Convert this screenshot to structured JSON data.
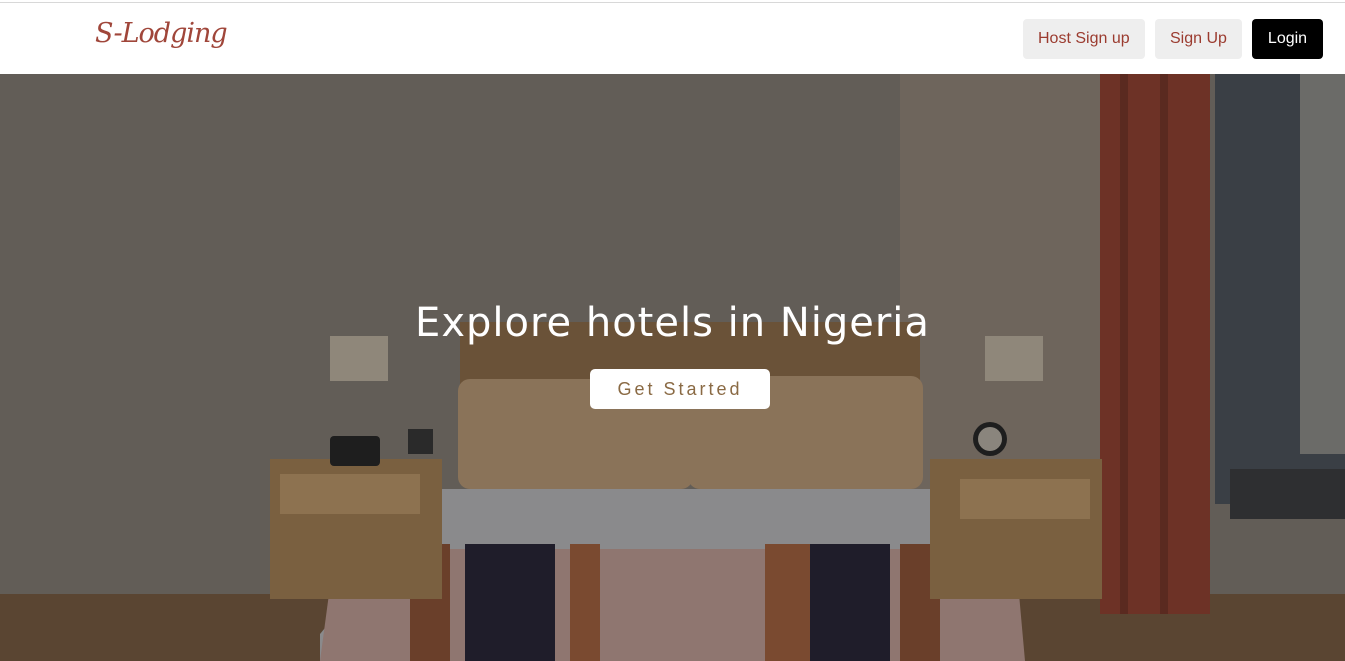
{
  "brand": {
    "logo_text": "S-Lodging",
    "accent": "#a0463a"
  },
  "nav": {
    "host_signup": "Host Sign up",
    "signup": "Sign Up",
    "login": "Login"
  },
  "hero": {
    "title": "Explore hotels in Nigeria",
    "cta": "Get Started",
    "background_image": "hotel bedroom with bed, nightstands, lamps and curtains"
  }
}
